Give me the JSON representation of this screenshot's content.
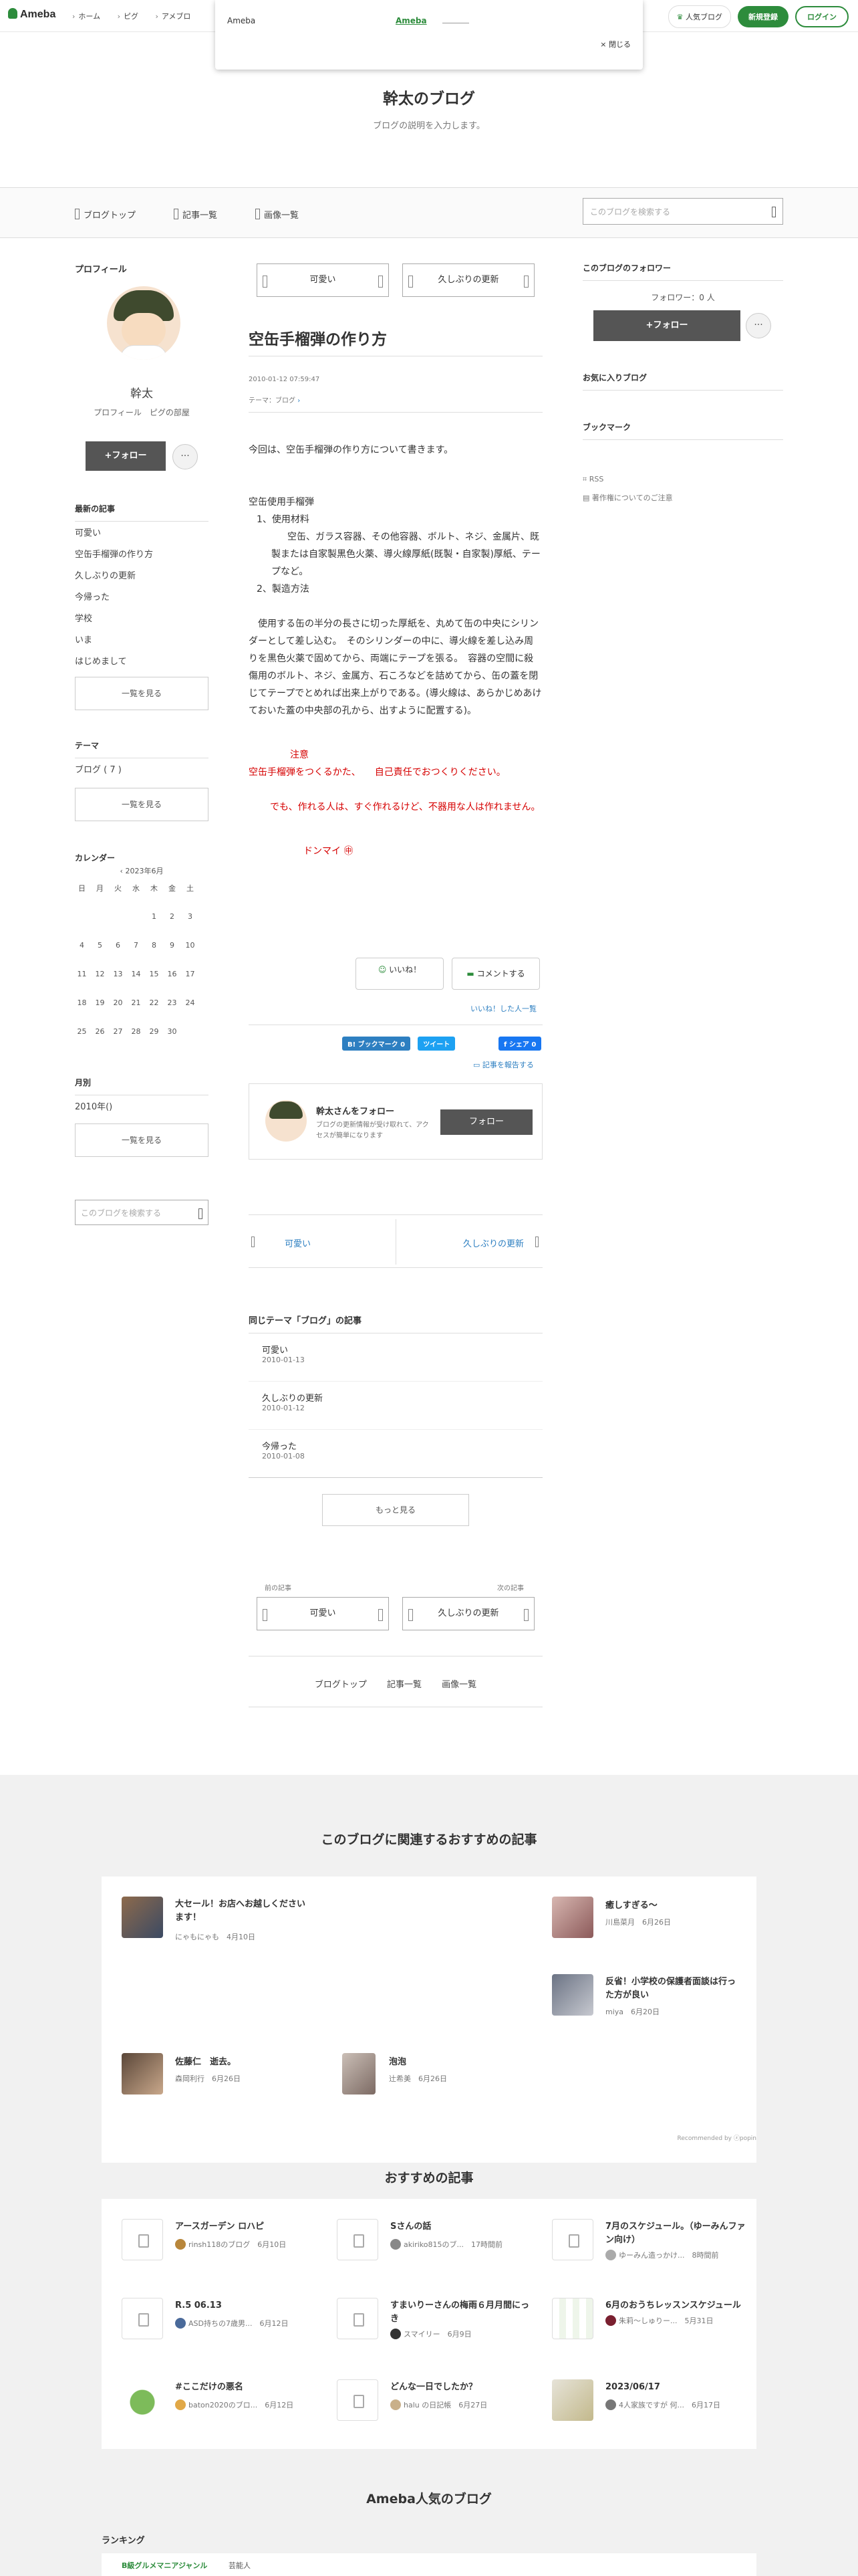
{
  "header": {
    "logo": "Ameba",
    "nav": [
      "ホーム",
      "ピグ",
      "アメブロ"
    ],
    "popular": "人気ブログ",
    "signup": "新規登録",
    "login": "ログイン"
  },
  "modal": {
    "title": "Ameba",
    "link": "Ameba",
    "close": "× 閉じる"
  },
  "blog": {
    "title": "幹太のブログ",
    "description": "ブログの説明を入力します。"
  },
  "nav2": {
    "top": "ブログトップ",
    "list": "記事一覧",
    "images": "画像一覧",
    "search_placeholder": "このブログを検索する"
  },
  "profile": {
    "heading": "プロフィール",
    "name": "幹太",
    "links": "プロフィール　ピグの部屋",
    "follow": "+フォロー",
    "more": "···"
  },
  "recent": {
    "heading": "最新の記事",
    "items": [
      "可愛い",
      "空缶手榴弾の作り方",
      "久しぶりの更新",
      "今帰った",
      "学校",
      "いま",
      "はじめまして"
    ],
    "more": "一覧を見る"
  },
  "theme": {
    "heading": "テーマ",
    "item": "ブログ ( 7 )",
    "more": "一覧を見る"
  },
  "calendar": {
    "heading": "カレンダー",
    "month": "2023年6月",
    "days": [
      "日",
      "月",
      "火",
      "水",
      "木",
      "金",
      "土"
    ],
    "weeks": [
      [
        "",
        "",
        "",
        "",
        "1",
        "2",
        "3"
      ],
      [
        "4",
        "5",
        "6",
        "7",
        "8",
        "9",
        "10"
      ],
      [
        "11",
        "12",
        "13",
        "14",
        "15",
        "16",
        "17"
      ],
      [
        "18",
        "19",
        "20",
        "21",
        "22",
        "23",
        "24"
      ],
      [
        "25",
        "26",
        "27",
        "28",
        "29",
        "30",
        ""
      ]
    ]
  },
  "monthly": {
    "heading": "月別",
    "item": "2010年()",
    "more": "一覧を見る"
  },
  "side_search": "このブログを検索する",
  "article": {
    "prev_top": "可愛い",
    "next_top": "久しぶりの更新",
    "title": "空缶手榴弾の作り方",
    "date": "2010-01-12 07:59:47",
    "theme": "テーマ：ブログ",
    "intro": "今回は、空缶手榴弾の作り方について書きます。",
    "sec1": "空缶使用手榴弾",
    "sec1a": "1、使用材料",
    "sec1b": "空缶、ガラス容器、その他容器、ボルト、ネジ、金属片、既製または自家製黒色火薬、導火線厚紙(既製・自家製)厚紙、テープなど。",
    "sec1c": "2、製造方法",
    "body": "　使用する缶の半分の長さに切った厚紙を、丸めて缶の中央にシリンダーとして差し込む。　そのシリンダーの中に、導火線を差し込み周りを黒色火薬で固めてから、両端にテープを張る。　容器の空間に殺傷用のボルト、ネジ、金属方、石ころなどを詰めてから、缶の蓋を閉じてテープでとめれば出来上がりである。(導火線は、あらかじめあけておいた蓋の中央部の孔から、出すように配置する)。",
    "warn_head": "注意",
    "warn1": "空缶手榴弾をつくるかた、　　自己責任でおつくりください。",
    "warn2": "でも、作れる人は、すぐ作れるけど、不器用な人は作れません。",
    "sign": "ドンマイ",
    "like": "いいね！",
    "comment": "コメントする",
    "liked": "いいね！した人一覧",
    "bookmark": "B! ブックマーク 0",
    "tweet": "ツイート",
    "fb_share": "シェア",
    "report": "記事を報告する",
    "follow_title": "幹太さんをフォロー",
    "follow_desc": "ブログの更新情報が受け取れて、アクセスが簡単になります",
    "follow_btn": "フォロー",
    "prev_mid": "可愛い",
    "next_mid": "久しぶりの更新"
  },
  "same_theme": {
    "heading": "同じテーマ「ブログ」の記事",
    "items": [
      {
        "title": "可愛い",
        "date": "2010-01-13"
      },
      {
        "title": "久しぶりの更新",
        "date": "2010-01-12"
      },
      {
        "title": "今帰った",
        "date": "2010-01-08"
      }
    ],
    "more": "もっと見る",
    "prev_label": "前の記事",
    "next_label": "次の記事",
    "prev": "可愛い",
    "next": "久しぶりの更新"
  },
  "bottom_nav": [
    "ブログトップ",
    "記事一覧",
    "画像一覧"
  ],
  "right": {
    "followers_heading": "このブログのフォロワー",
    "followers": "フォロワー：0 人",
    "follow": "+フォロー",
    "fav_heading": "お気に入りブログ",
    "bm_heading": "ブックマーク",
    "rss": "RSS",
    "copyright": "著作権についてのご注意"
  },
  "related": {
    "heading": "このブログに関連するおすすめの記事",
    "items": [
      {
        "title": "大セール！お店へお越しくださいます！",
        "author": "にゃもにゃも",
        "date": "4月10日"
      },
      {
        "title": "癒しすぎる〜",
        "author": "川島菜月",
        "date": "6月26日"
      },
      {
        "title": "反省！小学校の保護者面談は行った方が良い",
        "author": "miya",
        "date": "6月20日"
      },
      {
        "title": "佐藤仁　逝去。",
        "author": "森岡利行",
        "date": "6月26日"
      },
      {
        "title": "泡泡",
        "author": "辻希美",
        "date": "6月26日"
      }
    ],
    "credit": "Recommended by ⓩpopin"
  },
  "recommend": {
    "heading": "おすすめの記事",
    "items": [
      {
        "title": "アースガーデン ロハピ",
        "author": "rinsh118のブログ",
        "date": "6月10日"
      },
      {
        "title": "Sさんの話",
        "author": "akiriko815のブ...",
        "date": "17時間前"
      },
      {
        "title": "7月のスケジュール。（ゆーみんファン向け）",
        "author": "ゆーみん造っかけ...",
        "date": "8時間前"
      },
      {
        "title": "R.5 06.13",
        "author": "ASD持ちの7歳男...",
        "date": "6月12日"
      },
      {
        "title": "すまいりーさんの梅雨６月月間にっき",
        "author": "スマイリー",
        "date": "6月9日"
      },
      {
        "title": "6月のおうちレッスンスケジュール",
        "author": "朱莉〜しゅりー...",
        "date": "5月31日"
      },
      {
        "title": "#ここだけの悪名",
        "author": "baton2020のブロ...",
        "date": "6月12日"
      },
      {
        "title": "どんな一日でしたか？",
        "author": "halu の日記帳",
        "date": "6月27日"
      },
      {
        "title": "2023/06/17",
        "author": "4人家族ですが 何...",
        "date": "6月17日"
      }
    ]
  },
  "popular": {
    "heading": "Ameba人気のブログ",
    "ranking": "ランキング",
    "tab1": "B級グルメマニアジャンル",
    "tab2": "芸能人"
  }
}
